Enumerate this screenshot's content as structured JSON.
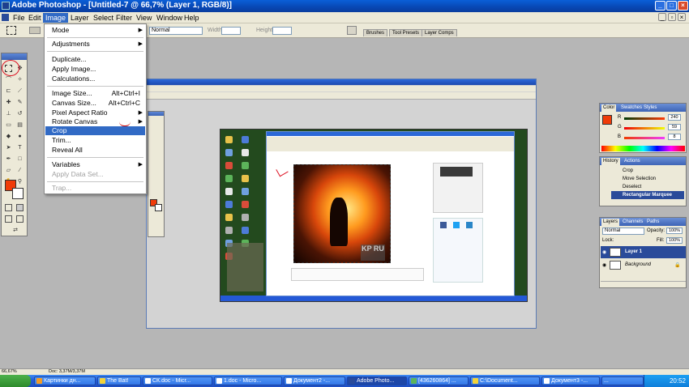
{
  "window": {
    "title": "Adobe Photoshop - [Untitled-7 @ 66,7% (Layer 1, RGB/8)]"
  },
  "menubar": [
    "File",
    "Edit",
    "Image",
    "Layer",
    "Select",
    "Filter",
    "View",
    "Window",
    "Help"
  ],
  "optbar": {
    "mode_value": "Normal",
    "width_label": "Width:",
    "height_label": "Height:",
    "palette_tabs": [
      "Brushes",
      "Tool Presets",
      "Layer Comps"
    ]
  },
  "image_menu": {
    "items": [
      {
        "label": "Mode",
        "submenu": true
      },
      {
        "label": "Adjustments",
        "submenu": true
      },
      {
        "label": "Duplicate..."
      },
      {
        "label": "Apply Image..."
      },
      {
        "label": "Calculations..."
      },
      {
        "label": "Image Size...",
        "shortcut": "Alt+Ctrl+I"
      },
      {
        "label": "Canvas Size...",
        "shortcut": "Alt+Ctrl+C"
      },
      {
        "label": "Pixel Aspect Ratio",
        "submenu": true
      },
      {
        "label": "Rotate Canvas",
        "submenu": true
      },
      {
        "label": "Crop",
        "highlighted": true
      },
      {
        "label": "Trim..."
      },
      {
        "label": "Reveal All"
      },
      {
        "label": "Variables",
        "submenu": true
      },
      {
        "label": "Apply Data Set...",
        "disabled": true
      },
      {
        "label": "Trap...",
        "disabled": true
      }
    ]
  },
  "color_palette": {
    "tabs": [
      "Color",
      "Swatches",
      "Styles"
    ],
    "r_label": "R",
    "g_label": "G",
    "b_label": "B",
    "r": "240",
    "g": "59",
    "b": "8",
    "fg_color": "#f03b08"
  },
  "history_palette": {
    "tabs": [
      "History",
      "Actions"
    ],
    "items": [
      "Crop",
      "Move Selection",
      "Deselect",
      "Rectangular Marquee"
    ]
  },
  "layers_palette": {
    "tabs": [
      "Layers",
      "Channels",
      "Paths"
    ],
    "blend_mode": "Normal",
    "opacity_label": "Opacity:",
    "opacity": "100%",
    "lock_label": "Lock:",
    "fill_label": "Fill:",
    "fill": "100%",
    "layers": [
      "Layer 1",
      "Background"
    ]
  },
  "status": {
    "zoom": "66,67%",
    "doc": "Doc: 3,37M/3,37M"
  },
  "taskbar": {
    "tasks": [
      "Картинки дн...",
      "The Bat!",
      "СК.doc - Micr...",
      "1.doc - Micro...",
      "Документ2 -...",
      "Adobe Photo...",
      "[436260864] ...",
      "C:\\Document...",
      "Документ3 -..."
    ],
    "clock": "20:52"
  }
}
